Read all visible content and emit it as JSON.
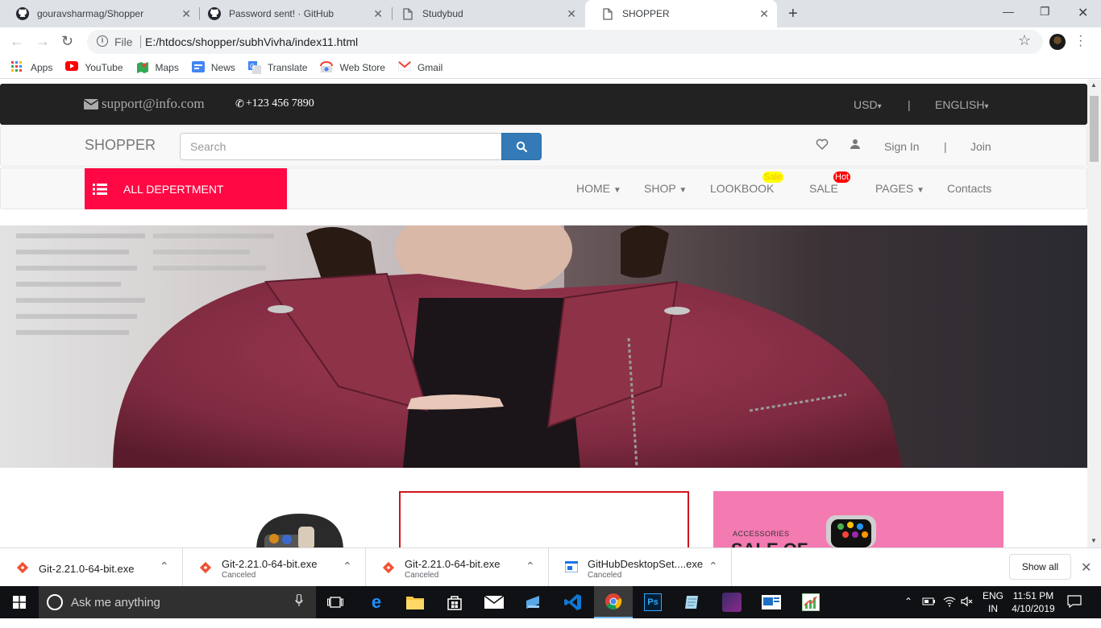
{
  "browser": {
    "tabs": [
      {
        "title": "gouravsharmag/Shopper",
        "icon": "github-icon"
      },
      {
        "title": "Password sent! · GitHub",
        "icon": "github-icon"
      },
      {
        "title": "Studybud",
        "icon": "page-icon"
      },
      {
        "title": "SHOPPER",
        "icon": "page-icon",
        "active": true
      }
    ],
    "omnibox": {
      "scheme": "File",
      "url": "E:/htdocs/shopper/subhVivha/index11.html"
    },
    "bookmarks": [
      {
        "label": "Apps",
        "icon": "apps-grid-icon"
      },
      {
        "label": "YouTube",
        "icon": "youtube-icon"
      },
      {
        "label": "Maps",
        "icon": "maps-icon"
      },
      {
        "label": "News",
        "icon": "news-icon"
      },
      {
        "label": "Translate",
        "icon": "translate-icon"
      },
      {
        "label": "Web Store",
        "icon": "webstore-icon"
      },
      {
        "label": "Gmail",
        "icon": "gmail-icon"
      }
    ]
  },
  "site": {
    "topbar": {
      "email": "support@info.com",
      "phone": "+123 456 7890",
      "currency": "USD",
      "pipe": "|",
      "language": "ENGLISH"
    },
    "header": {
      "brand": "SHOPPER",
      "search_placeholder": "Search",
      "sign_in": "Sign In",
      "pipe": "|",
      "join": "Join"
    },
    "nav": {
      "department": "ALL DEPERTMENT",
      "items": [
        {
          "label": "HOME",
          "caret": true
        },
        {
          "label": "SHOP",
          "caret": true
        },
        {
          "label": "LOOKBOOK",
          "badge": "Sale"
        },
        {
          "label": "SALE",
          "badge": "Hot"
        },
        {
          "label": "PAGES",
          "caret": true
        },
        {
          "label": "Contacts"
        }
      ]
    },
    "promo": {
      "tag": "ACCESSORIES",
      "headline": "SALE OF"
    },
    "colors": {
      "accent": "#ff0844",
      "search_button": "#337ab7",
      "sale_badge": "#ffff00",
      "hot_badge": "#ff0000"
    }
  },
  "downloads": {
    "items": [
      {
        "name": "Git-2.21.0-64-bit.exe",
        "status": ""
      },
      {
        "name": "Git-2.21.0-64-bit.exe",
        "status": "Canceled"
      },
      {
        "name": "Git-2.21.0-64-bit.exe",
        "status": "Canceled"
      },
      {
        "name": "GitHubDesktopSet....exe",
        "status": "Canceled"
      }
    ],
    "show_all": "Show all"
  },
  "taskbar": {
    "search_placeholder": "Ask me anything",
    "lang_top": "ENG",
    "lang_bottom": "IN",
    "time": "11:51 PM",
    "date": "4/10/2019"
  }
}
